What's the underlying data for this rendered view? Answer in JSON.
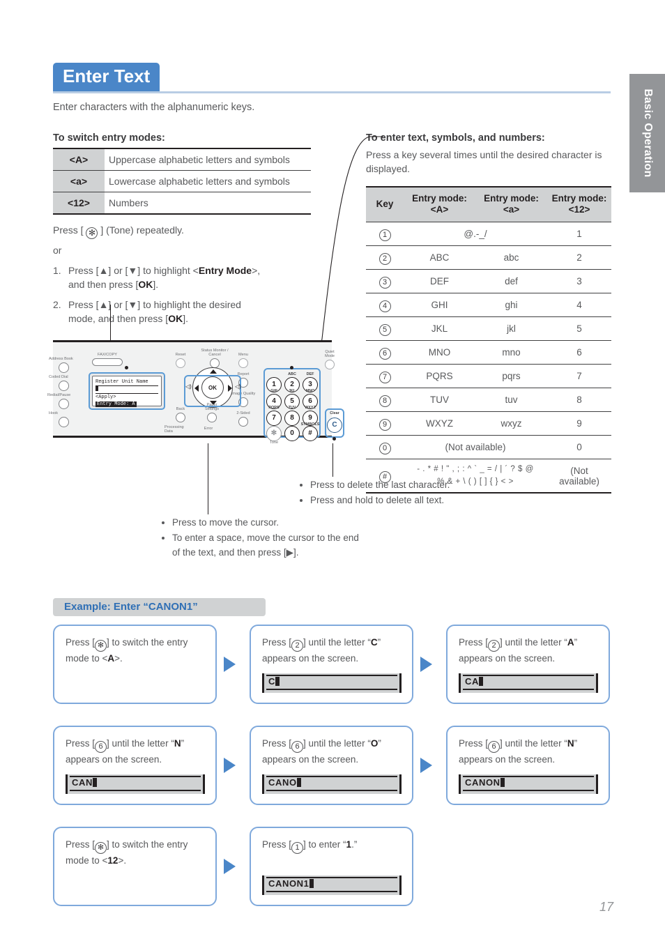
{
  "side_tab": {
    "label": "Basic Operation"
  },
  "page": {
    "number": "17"
  },
  "header": {
    "title": "Enter Text",
    "intro": "Enter characters with the alphanumeric keys."
  },
  "switch_modes": {
    "heading": "To switch entry modes:",
    "rows": [
      {
        "key": "<A>",
        "desc": "Uppercase alphabetic letters and symbols"
      },
      {
        "key": "<a>",
        "desc": "Lowercase alphabetic letters and symbols"
      },
      {
        "key": "<12>",
        "desc": "Numbers"
      }
    ],
    "press_prefix": "Press [",
    "press_suffix": "] (Tone) repeatedly.",
    "tone_key": "✻",
    "or": "or",
    "steps": [
      {
        "num": "1.",
        "text_a": "Press [▲] or [▼] to highlight <",
        "bold": "Entry Mode",
        "text_b": ">,",
        "line2_a": "and then press [",
        "line2_bold": "OK",
        "line2_b": "]."
      },
      {
        "num": "2.",
        "text_a": "Press [▲] or [▼] to highlight the desired",
        "bold": "",
        "text_b": "",
        "line2_a": "mode, and then press [",
        "line2_bold": "OK",
        "line2_b": "]."
      }
    ]
  },
  "enter_text": {
    "heading": "To enter text, symbols, and numbers:",
    "subtext": "Press a key several times until the desired character is displayed.",
    "columns": [
      "Key",
      "Entry mode:\n<A>",
      "Entry mode:\n<a>",
      "Entry mode:\n<12>"
    ],
    "col_key": "Key",
    "col_a_1": "Entry mode:",
    "col_a_2": "<A>",
    "col_b_1": "Entry mode:",
    "col_b_2": "<a>",
    "col_c_1": "Entry mode:",
    "col_c_2": "<12>",
    "rows": [
      {
        "key": "1",
        "upper": "@.-_/",
        "lower": "",
        "num": "1",
        "span": true
      },
      {
        "key": "2",
        "upper": "ABC",
        "lower": "abc",
        "num": "2"
      },
      {
        "key": "3",
        "upper": "DEF",
        "lower": "def",
        "num": "3"
      },
      {
        "key": "4",
        "upper": "GHI",
        "lower": "ghi",
        "num": "4"
      },
      {
        "key": "5",
        "upper": "JKL",
        "lower": "jkl",
        "num": "5"
      },
      {
        "key": "6",
        "upper": "MNO",
        "lower": "mno",
        "num": "6"
      },
      {
        "key": "7",
        "upper": "PQRS",
        "lower": "pqrs",
        "num": "7"
      },
      {
        "key": "8",
        "upper": "TUV",
        "lower": "tuv",
        "num": "8"
      },
      {
        "key": "9",
        "upper": "WXYZ",
        "lower": "wxyz",
        "num": "9"
      },
      {
        "key": "0",
        "upper": "(Not available)",
        "lower": "",
        "num": "0",
        "span": true
      }
    ],
    "hash_row": {
      "key": "#",
      "symbols_line1": "- . * # ! \" , ; : ^ ` _ = / | ´ ? $ @",
      "symbols_line2": "% & + \\ ( ) [ ] { } < >",
      "num": "(Not available)"
    }
  },
  "device": {
    "lcd": {
      "line1": "Register Unit Name",
      "line2": "",
      "line3": "<Apply>",
      "line4": "Entry Mode: A"
    },
    "labels": {
      "address_book": "Address Book",
      "coded_dial": "Coded Dial",
      "redial_pause": "Redial/Pause",
      "hook": "Hook",
      "fax_copy": "FAX/COPY",
      "reset": "Reset",
      "status_monitor": "Status Monitor /",
      "status_monitor2": "Cancel",
      "menu": "Menu",
      "report": "Report",
      "image_quality": "Image Quality",
      "back": "Back",
      "paper_settings": "Paper",
      "paper_settings2": "Settings",
      "two_sided": "2-Sided",
      "quiet_mode": "Quiet",
      "quiet_mode2": "Mode",
      "processing": "Processing",
      "processing2": "Data",
      "error": "Error",
      "tone": "Tone",
      "clear": "Clear",
      "ok": "OK"
    },
    "keypad": [
      {
        "num": "1",
        "letters": ""
      },
      {
        "num": "2",
        "letters": "ABC"
      },
      {
        "num": "3",
        "letters": "DEF"
      },
      {
        "num": "4",
        "letters": "GHI"
      },
      {
        "num": "5",
        "letters": "JKL"
      },
      {
        "num": "6",
        "letters": "MNO"
      },
      {
        "num": "7",
        "letters": "PQRS"
      },
      {
        "num": "8",
        "letters": "TUV"
      },
      {
        "num": "9",
        "letters": "WXYZ"
      },
      {
        "num": "0",
        "letters": ""
      },
      {
        "num": "#",
        "letters": "SYMBOLS"
      }
    ]
  },
  "callouts": {
    "clear": [
      "Press to delete the last character.",
      "Press and hold to delete all text."
    ],
    "cursor": [
      "Press to move the cursor.",
      "To enter a space, move the cursor to the end of the text, and then press [▶]."
    ],
    "cursor_1": "Press to move the cursor.",
    "cursor_2a": "To enter a space, move the cursor to the end",
    "cursor_2b": "of the text, and then press [▶]."
  },
  "example": {
    "heading": "Example: Enter “CANON1”",
    "steps": [
      {
        "key": "✻",
        "text_a": "Press [",
        "text_b": "] to switch the entry mode to <",
        "bold": "A",
        "text_c": ">.",
        "screen": ""
      },
      {
        "key": "2",
        "text_a": "Press [",
        "text_b": "] until the letter “",
        "bold": "C",
        "text_c": "” appears on the screen.",
        "screen": "C"
      },
      {
        "key": "2",
        "text_a": "Press [",
        "text_b": "] until the letter “",
        "bold": "A",
        "text_c": "” appears on the screen.",
        "screen": "CA"
      },
      {
        "key": "6",
        "text_a": "Press [",
        "text_b": "] until the letter “",
        "bold": "N",
        "text_c": "” appears on the screen.",
        "screen": "CAN"
      },
      {
        "key": "6",
        "text_a": "Press [",
        "text_b": "] until the letter “",
        "bold": "O",
        "text_c": "” appears on the screen.",
        "screen": "CANO"
      },
      {
        "key": "6",
        "text_a": "Press [",
        "text_b": "] until the letter “",
        "bold": "N",
        "text_c": "” appears on the screen.",
        "screen": "CANON"
      },
      {
        "key": "✻",
        "text_a": "Press [",
        "text_b": "] to switch the entry mode to <",
        "bold": "12",
        "text_c": ">.",
        "screen": ""
      },
      {
        "key": "1",
        "text_a": "Press [",
        "text_b": "] to enter “",
        "bold": "1",
        "text_c": ".”",
        "screen": "CANON1"
      }
    ]
  },
  "colors": {
    "title_blue": "#4a86c8",
    "tab_gray": "#939598",
    "header_gray": "#d0d2d3",
    "box_border_blue": "#7fa9dc",
    "accent_blue": "#5b9bd5"
  }
}
